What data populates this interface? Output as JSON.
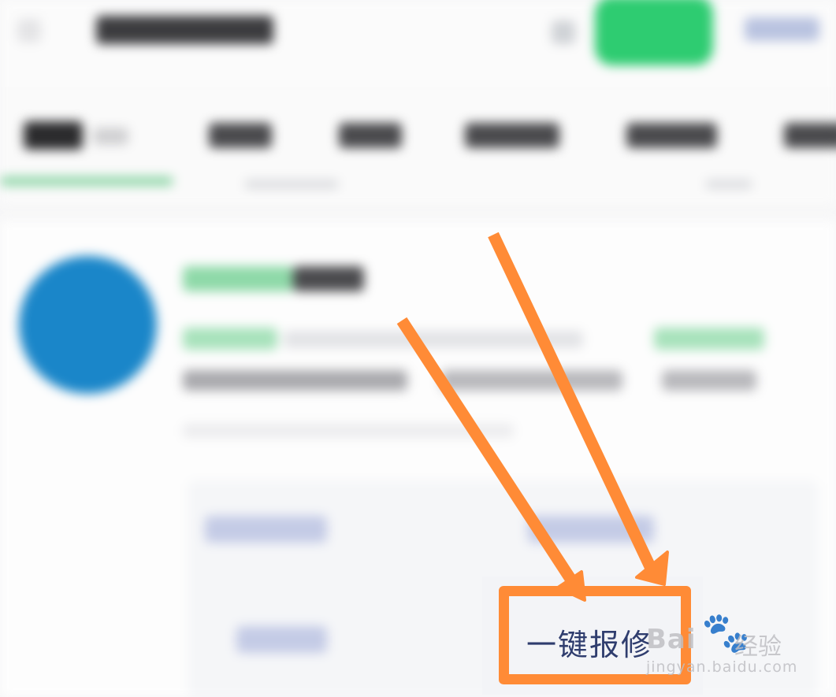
{
  "repair_button": {
    "label": "一键报修"
  },
  "watermark": {
    "brand": "Bai",
    "paw": "🐾",
    "jingyan": "经验",
    "url": "jingyan.baidu.com"
  },
  "colors": {
    "annotation_orange": "#ff8b36",
    "primary_green": "#2ecc71",
    "avatar_blue": "#1a86c9",
    "label_navy": "#2f3d6e"
  }
}
